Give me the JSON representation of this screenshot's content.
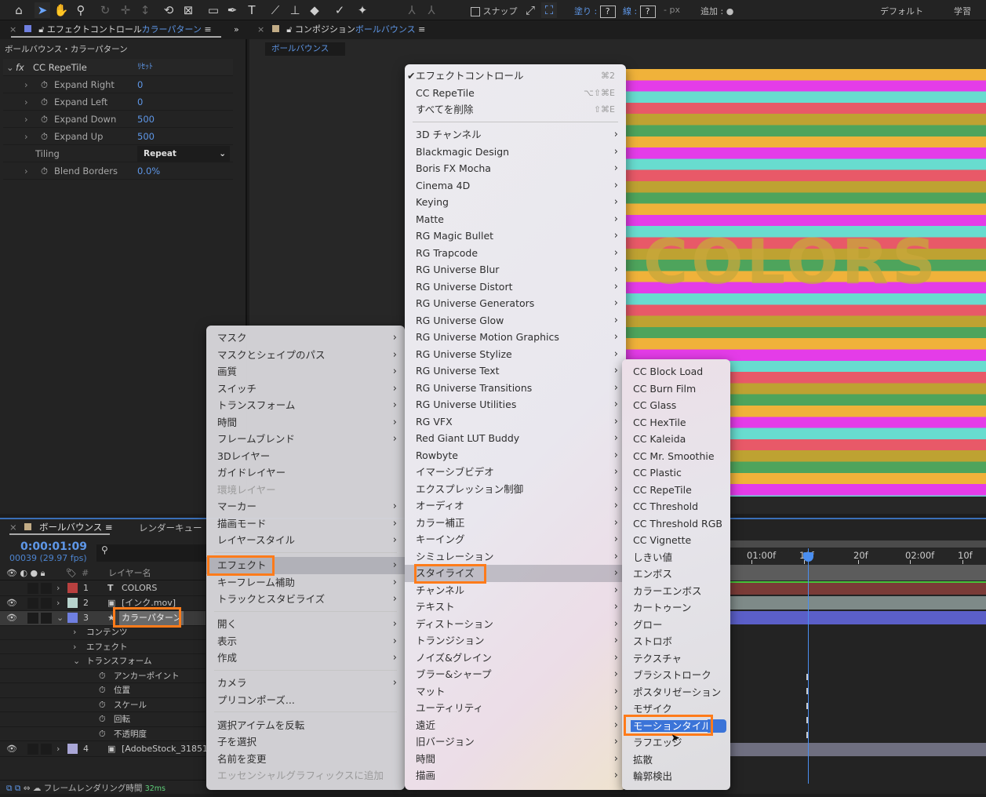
{
  "toolbar": {
    "snap_label": "スナップ",
    "fill_label": "塗り :",
    "fill_value": "?",
    "stroke_label": "線 :",
    "stroke_value": "?",
    "px_label": "- px",
    "add_label": "追加 :",
    "workspace_default": "デフォルト",
    "workspace_learn": "学習",
    "icons": [
      "home-icon",
      "selection-arrow-icon",
      "hand-icon",
      "zoom-icon",
      "orbit-camera-icon",
      "pan-camera-icon",
      "dolly-camera-icon",
      "rotate-icon",
      "anchor-point-icon",
      "rectangle-icon",
      "pen-icon",
      "type-icon",
      "brush-icon",
      "clone-stamp-icon",
      "eraser-icon",
      "roto-brush-icon",
      "puppet-pin-icon"
    ]
  },
  "effect_panel": {
    "tab_prefix": "エフェクトコントロール",
    "tab_layer": "カラーパターン",
    "subtitle": "ボールバウンス・カラーパターン",
    "effect_name": "CC RepeTile",
    "reset_label": "ﾘｾｯﾄ",
    "params": [
      {
        "name": "Expand Right",
        "value": "0"
      },
      {
        "name": "Expand Left",
        "value": "0"
      },
      {
        "name": "Expand Down",
        "value": "500"
      },
      {
        "name": "Expand Up",
        "value": "500"
      }
    ],
    "tiling_label": "Tiling",
    "tiling_value": "Repeat",
    "blend_label": "Blend Borders",
    "blend_value": "0.0%"
  },
  "comp_panel": {
    "tab_prefix": "コンポジション",
    "tab_comp": "ボールバウンス",
    "comp_tab": "ボールバウンス",
    "preview_text": "COLORS"
  },
  "timeline": {
    "tab": "ボールバウンス",
    "render_queue": "レンダーキュー",
    "timecode": "0:00:01:09",
    "frame_info": "00039 (29.97 fps)",
    "col_layer_name": "レイヤー名",
    "col_hash": "#",
    "ruler": [
      "01:00f",
      "10f",
      "20f",
      "02:00f",
      "10f"
    ],
    "layers": [
      {
        "num": "1",
        "name": "COLORS",
        "type": "T",
        "color": "#b8403f"
      },
      {
        "num": "2",
        "name": "[インク.mov]",
        "type": "file",
        "color": "#b7d3cd"
      },
      {
        "num": "3",
        "name": "カラーパターン",
        "type": "star",
        "color": "#6f7fe0"
      },
      {
        "num": "4",
        "name": "[AdobeStock_31851",
        "type": "file",
        "color": "#a9a6d6"
      }
    ],
    "props": [
      {
        "label": "コンテンツ",
        "chev": "›"
      },
      {
        "label": "エフェクト",
        "chev": "›"
      },
      {
        "label": "トランスフォーム",
        "chev": "⌄"
      },
      {
        "label": "アンカーポイント"
      },
      {
        "label": "位置"
      },
      {
        "label": "スケール"
      },
      {
        "label": "回転"
      },
      {
        "label": "不透明度"
      }
    ],
    "footer_label": "フレームレンダリング時間",
    "footer_value": "32ms"
  },
  "menu_layer": [
    {
      "label": "マスク",
      "sub": true
    },
    {
      "label": "マスクとシェイプのパス",
      "sub": true
    },
    {
      "label": "画質",
      "sub": true
    },
    {
      "label": "スイッチ",
      "sub": true
    },
    {
      "label": "トランスフォーム",
      "sub": true
    },
    {
      "label": "時間",
      "sub": true
    },
    {
      "label": "フレームブレンド",
      "sub": true
    },
    {
      "label": "3Dレイヤー"
    },
    {
      "label": "ガイドレイヤー"
    },
    {
      "label": "環境レイヤー",
      "disabled": true
    },
    {
      "label": "マーカー",
      "sub": true
    },
    {
      "label": "描画モード",
      "sub": true
    },
    {
      "label": "レイヤースタイル",
      "sub": true
    },
    {
      "sep": true
    },
    {
      "label": "エフェクト",
      "sub": true,
      "highlight": true
    },
    {
      "label": "キーフレーム補助",
      "sub": true
    },
    {
      "label": "トラックとスタビライズ",
      "sub": true
    },
    {
      "sep": true
    },
    {
      "label": "開く",
      "sub": true
    },
    {
      "label": "表示",
      "sub": true
    },
    {
      "label": "作成",
      "sub": true
    },
    {
      "sep": true
    },
    {
      "label": "カメラ",
      "sub": true
    },
    {
      "label": "プリコンポーズ..."
    },
    {
      "sep": true
    },
    {
      "label": "選択アイテムを反転"
    },
    {
      "label": "子を選択"
    },
    {
      "label": "名前を変更"
    },
    {
      "label": "エッセンシャルグラフィックスに追加",
      "disabled": true
    }
  ],
  "menu_effect": [
    {
      "label": "エフェクトコントロール",
      "check": true,
      "shortcut": "⌘2"
    },
    {
      "label": "CC RepeTile",
      "shortcut": "⌥⇧⌘E"
    },
    {
      "label": "すべてを削除",
      "shortcut": "⇧⌘E"
    },
    {
      "sep": true
    },
    {
      "label": "3D チャンネル",
      "sub": true
    },
    {
      "label": "Blackmagic Design",
      "sub": true
    },
    {
      "label": "Boris FX Mocha",
      "sub": true
    },
    {
      "label": "Cinema 4D",
      "sub": true
    },
    {
      "label": "Keying",
      "sub": true
    },
    {
      "label": "Matte",
      "sub": true
    },
    {
      "label": "RG Magic Bullet",
      "sub": true
    },
    {
      "label": "RG Trapcode",
      "sub": true
    },
    {
      "label": "RG Universe Blur",
      "sub": true
    },
    {
      "label": "RG Universe Distort",
      "sub": true
    },
    {
      "label": "RG Universe Generators",
      "sub": true
    },
    {
      "label": "RG Universe Glow",
      "sub": true
    },
    {
      "label": "RG Universe Motion Graphics",
      "sub": true
    },
    {
      "label": "RG Universe Stylize",
      "sub": true
    },
    {
      "label": "RG Universe Text",
      "sub": true
    },
    {
      "label": "RG Universe Transitions",
      "sub": true
    },
    {
      "label": "RG Universe Utilities",
      "sub": true
    },
    {
      "label": "RG VFX",
      "sub": true
    },
    {
      "label": "Red Giant LUT Buddy",
      "sub": true
    },
    {
      "label": "Rowbyte",
      "sub": true
    },
    {
      "label": "イマーシブビデオ",
      "sub": true
    },
    {
      "label": "エクスプレッション制御",
      "sub": true
    },
    {
      "label": "オーディオ",
      "sub": true
    },
    {
      "label": "カラー補正",
      "sub": true
    },
    {
      "label": "キーイング",
      "sub": true
    },
    {
      "label": "シミュレーション",
      "sub": true
    },
    {
      "label": "スタイライズ",
      "sub": true,
      "highlight": true
    },
    {
      "label": "チャンネル",
      "sub": true
    },
    {
      "label": "テキスト",
      "sub": true
    },
    {
      "label": "ディストーション",
      "sub": true
    },
    {
      "label": "トランジション",
      "sub": true
    },
    {
      "label": "ノイズ&グレイン",
      "sub": true
    },
    {
      "label": "ブラー&シャープ",
      "sub": true
    },
    {
      "label": "マット",
      "sub": true
    },
    {
      "label": "ユーティリティ",
      "sub": true
    },
    {
      "label": "遠近",
      "sub": true
    },
    {
      "label": "旧バージョン",
      "sub": true
    },
    {
      "label": "時間",
      "sub": true
    },
    {
      "label": "描画",
      "sub": true
    }
  ],
  "menu_stylize": [
    {
      "label": "CC Block Load"
    },
    {
      "label": "CC Burn Film"
    },
    {
      "label": "CC Glass"
    },
    {
      "label": "CC HexTile"
    },
    {
      "label": "CC Kaleida"
    },
    {
      "label": "CC Mr. Smoothie"
    },
    {
      "label": "CC Plastic"
    },
    {
      "label": "CC RepeTile"
    },
    {
      "label": "CC Threshold"
    },
    {
      "label": "CC Threshold RGB"
    },
    {
      "label": "CC Vignette"
    },
    {
      "label": "しきい値"
    },
    {
      "label": "エンボス"
    },
    {
      "label": "カラーエンボス"
    },
    {
      "label": "カートゥーン"
    },
    {
      "label": "グロー"
    },
    {
      "label": "ストロボ"
    },
    {
      "label": "テクスチャ"
    },
    {
      "label": "ブラシストローク"
    },
    {
      "label": "ポスタリゼーション"
    },
    {
      "label": "モザイク"
    },
    {
      "label": "モーションタイル",
      "selected": true
    },
    {
      "label": "ラフエッジ"
    },
    {
      "label": "拡散"
    },
    {
      "label": "輪郭検出"
    }
  ],
  "colors": {
    "accent": "#5e97e8",
    "annotation": "#ff7b1a",
    "menu_selection": "#3b74d8",
    "playhead": "#4a8ef0"
  }
}
